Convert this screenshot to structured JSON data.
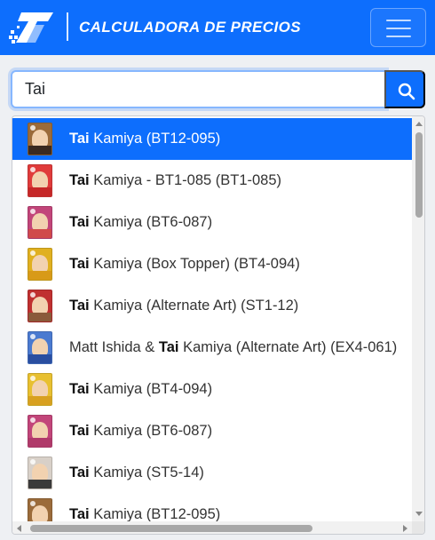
{
  "header": {
    "title": "CALCULADORA DE PRECIOS",
    "logo_icon": "brand-logo-icon",
    "menu_icon": "hamburger-menu-icon"
  },
  "search": {
    "value": "Tai",
    "placeholder": "",
    "button_icon": "search-icon"
  },
  "colors": {
    "primary": "#0d6efd",
    "selected_item": "#0d6efd"
  },
  "results": [
    {
      "pre": "",
      "match": "Tai",
      "post": " Kamiya (BT12-095)",
      "selected": true,
      "card_colors": [
        "#9b6b3a",
        "#3a2a20"
      ]
    },
    {
      "pre": "",
      "match": "Tai",
      "post": " Kamiya - BT1-085 (BT1-085)",
      "selected": false,
      "card_colors": [
        "#e03b3b",
        "#c62828"
      ]
    },
    {
      "pre": "",
      "match": "Tai",
      "post": " Kamiya (BT6-087)",
      "selected": false,
      "card_colors": [
        "#c2457a",
        "#d04a4a"
      ]
    },
    {
      "pre": "",
      "match": "Tai",
      "post": " Kamiya (Box Topper) (BT4-094)",
      "selected": false,
      "card_colors": [
        "#e0b020",
        "#d89a18"
      ]
    },
    {
      "pre": "",
      "match": "Tai",
      "post": " Kamiya (Alternate Art) (ST1-12)",
      "selected": false,
      "card_colors": [
        "#c03030",
        "#8a5a3a"
      ]
    },
    {
      "pre": "Matt Ishida & ",
      "match": "Tai",
      "post": " Kamiya (Alternate Art) (EX4-061)",
      "selected": false,
      "card_colors": [
        "#4a7ad0",
        "#2a4ea0"
      ]
    },
    {
      "pre": "",
      "match": "Tai",
      "post": " Kamiya (BT4-094)",
      "selected": false,
      "card_colors": [
        "#e8c030",
        "#d8a020"
      ]
    },
    {
      "pre": "",
      "match": "Tai",
      "post": " Kamiya (BT6-087)",
      "selected": false,
      "card_colors": [
        "#c2457a",
        "#b03a6a"
      ]
    },
    {
      "pre": "",
      "match": "Tai",
      "post": " Kamiya (ST5-14)",
      "selected": false,
      "card_colors": [
        "#d8d0c8",
        "#3a3a3a"
      ]
    },
    {
      "pre": "",
      "match": "Tai",
      "post": " Kamiya (BT12-095)",
      "selected": false,
      "card_colors": [
        "#9b6b3a",
        "#3a2a20"
      ]
    }
  ]
}
